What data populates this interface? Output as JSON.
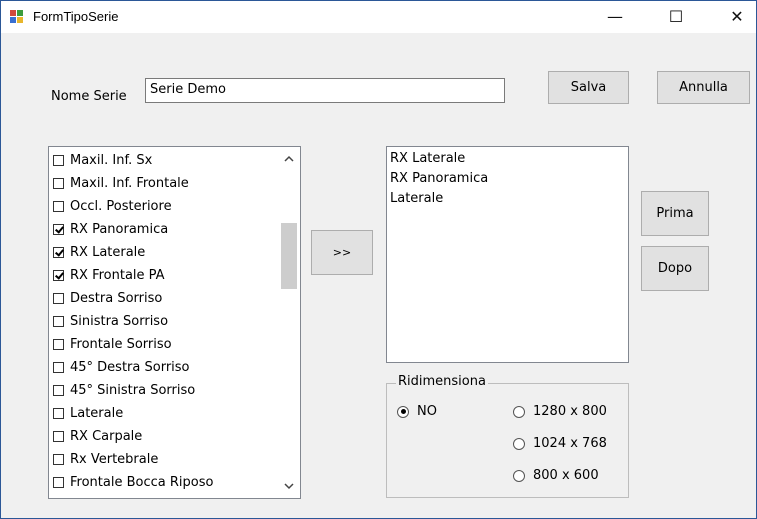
{
  "window": {
    "title": "FormTipoSerie",
    "minimize": "—",
    "maximize": "☐",
    "close": "✕"
  },
  "name_field": {
    "label": "Nome Serie",
    "value": "Serie Demo"
  },
  "buttons": {
    "save": "Salva",
    "cancel": "Annulla",
    "add": ">>",
    "before": "Prima",
    "after": "Dopo"
  },
  "checklist": [
    {
      "label": "Maxil. Inf. Sx",
      "checked": false
    },
    {
      "label": "Maxil. Inf. Frontale",
      "checked": false
    },
    {
      "label": "Occl. Posteriore",
      "checked": false
    },
    {
      "label": "RX Panoramica",
      "checked": true
    },
    {
      "label": "RX Laterale",
      "checked": true
    },
    {
      "label": "RX Frontale PA",
      "checked": true
    },
    {
      "label": "Destra Sorriso",
      "checked": false
    },
    {
      "label": "Sinistra Sorriso",
      "checked": false
    },
    {
      "label": "Frontale Sorriso",
      "checked": false
    },
    {
      "label": "45° Destra Sorriso",
      "checked": false
    },
    {
      "label": "45° Sinistra Sorriso",
      "checked": false
    },
    {
      "label": "Laterale",
      "checked": false
    },
    {
      "label": "RX Carpale",
      "checked": false
    },
    {
      "label": "Rx Vertebrale",
      "checked": false
    },
    {
      "label": "Frontale Bocca Riposo",
      "checked": false
    }
  ],
  "selected_list": [
    "RX Laterale",
    "RX Panoramica",
    "Laterale"
  ],
  "resize_group": {
    "title": "Ridimensiona",
    "options": [
      {
        "label": "NO",
        "checked": true
      },
      {
        "label": "1280 x 800",
        "checked": false
      },
      {
        "label": "1024 x 768",
        "checked": false
      },
      {
        "label": "800 x 600",
        "checked": false
      }
    ]
  }
}
